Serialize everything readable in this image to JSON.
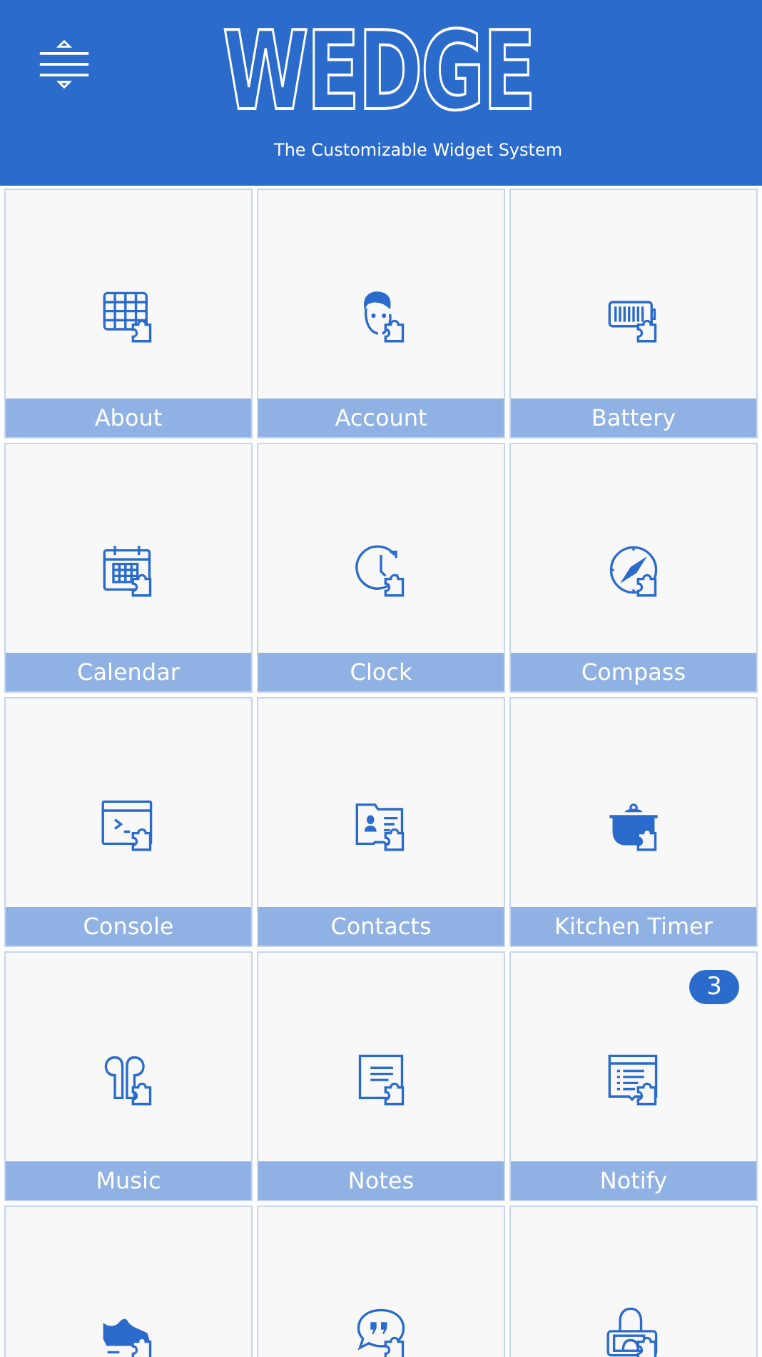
{
  "header": {
    "title": "WEDGE",
    "subtitle": "The Customizable Widget System"
  },
  "tiles": [
    {
      "kind": "widget",
      "label": "About"
    },
    {
      "kind": "widget",
      "label": "Account"
    },
    {
      "kind": "widget",
      "label": "Battery"
    },
    {
      "kind": "widget",
      "label": "Calendar"
    },
    {
      "kind": "widget",
      "label": "Clock"
    },
    {
      "kind": "widget",
      "label": "Compass"
    },
    {
      "kind": "widget",
      "label": "Console"
    },
    {
      "kind": "widget",
      "label": "Contacts"
    },
    {
      "kind": "widget",
      "label": "Kitchen Timer"
    },
    {
      "kind": "widget",
      "label": "Music"
    },
    {
      "kind": "widget",
      "label": "Notes"
    },
    {
      "kind": "widget",
      "label": "Notify",
      "badge": "3"
    },
    {
      "kind": "widget"
    },
    {
      "kind": "widget"
    },
    {
      "kind": "widget"
    }
  ]
}
